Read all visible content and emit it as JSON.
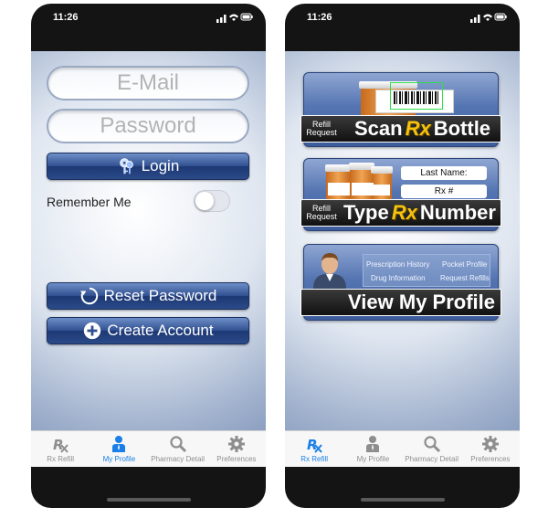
{
  "status": {
    "time": "11:26"
  },
  "login_screen": {
    "email_placeholder": "E-Mail",
    "password_placeholder": "Password",
    "login_label": "Login",
    "remember_label": "Remember Me",
    "remember_on": false,
    "reset_label": "Reset Password",
    "create_label": "Create Account"
  },
  "home_screen": {
    "scan": {
      "small": "Refill Request",
      "left": "Scan",
      "rx": "Rx",
      "right": "Bottle"
    },
    "type": {
      "small": "Refill Request",
      "left": "Type",
      "rx": "Rx",
      "right": "Number",
      "last_name_label": "Last Name:",
      "rx_number_label": "Rx #"
    },
    "profile": {
      "title": "View My Profile",
      "links": [
        "Prescription History",
        "Pocket Profile",
        "Drug Information",
        "Request Refills"
      ]
    }
  },
  "tabs_left": [
    {
      "label": "Rx Refill",
      "icon": "rx-icon",
      "active": false
    },
    {
      "label": "My Profile",
      "icon": "person-icon",
      "active": true
    },
    {
      "label": "Pharmacy Detail",
      "icon": "magnifier-icon",
      "active": false
    },
    {
      "label": "Preferences",
      "icon": "gear-icon",
      "active": false
    }
  ],
  "tabs_right": [
    {
      "label": "Rx Refill",
      "icon": "rx-icon",
      "active": true
    },
    {
      "label": "My Profile",
      "icon": "person-icon",
      "active": false
    },
    {
      "label": "Pharmacy Detail",
      "icon": "magnifier-icon",
      "active": false
    },
    {
      "label": "Preferences",
      "icon": "gear-icon",
      "active": false
    }
  ],
  "colors": {
    "accent": "#1a7fe8",
    "button_blue": "#2f4f8f",
    "rx_gold": "#f4c20d"
  }
}
